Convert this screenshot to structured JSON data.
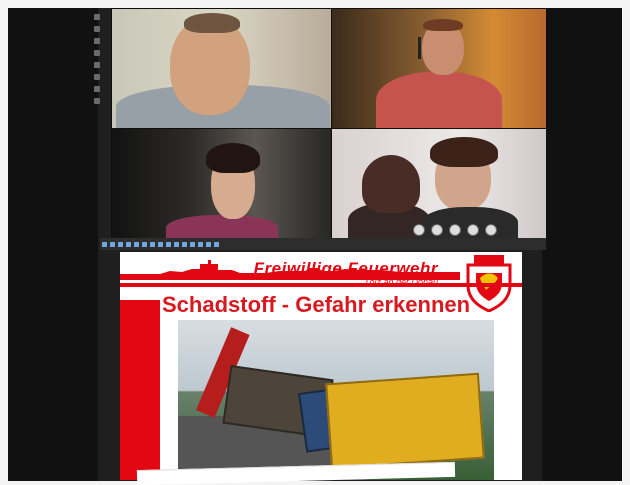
{
  "slide": {
    "brand": "Freiwillige Feuerwehr",
    "subbrand": "Tölz an der Donau",
    "title": "Schadstoff - Gefahr erkennen"
  }
}
